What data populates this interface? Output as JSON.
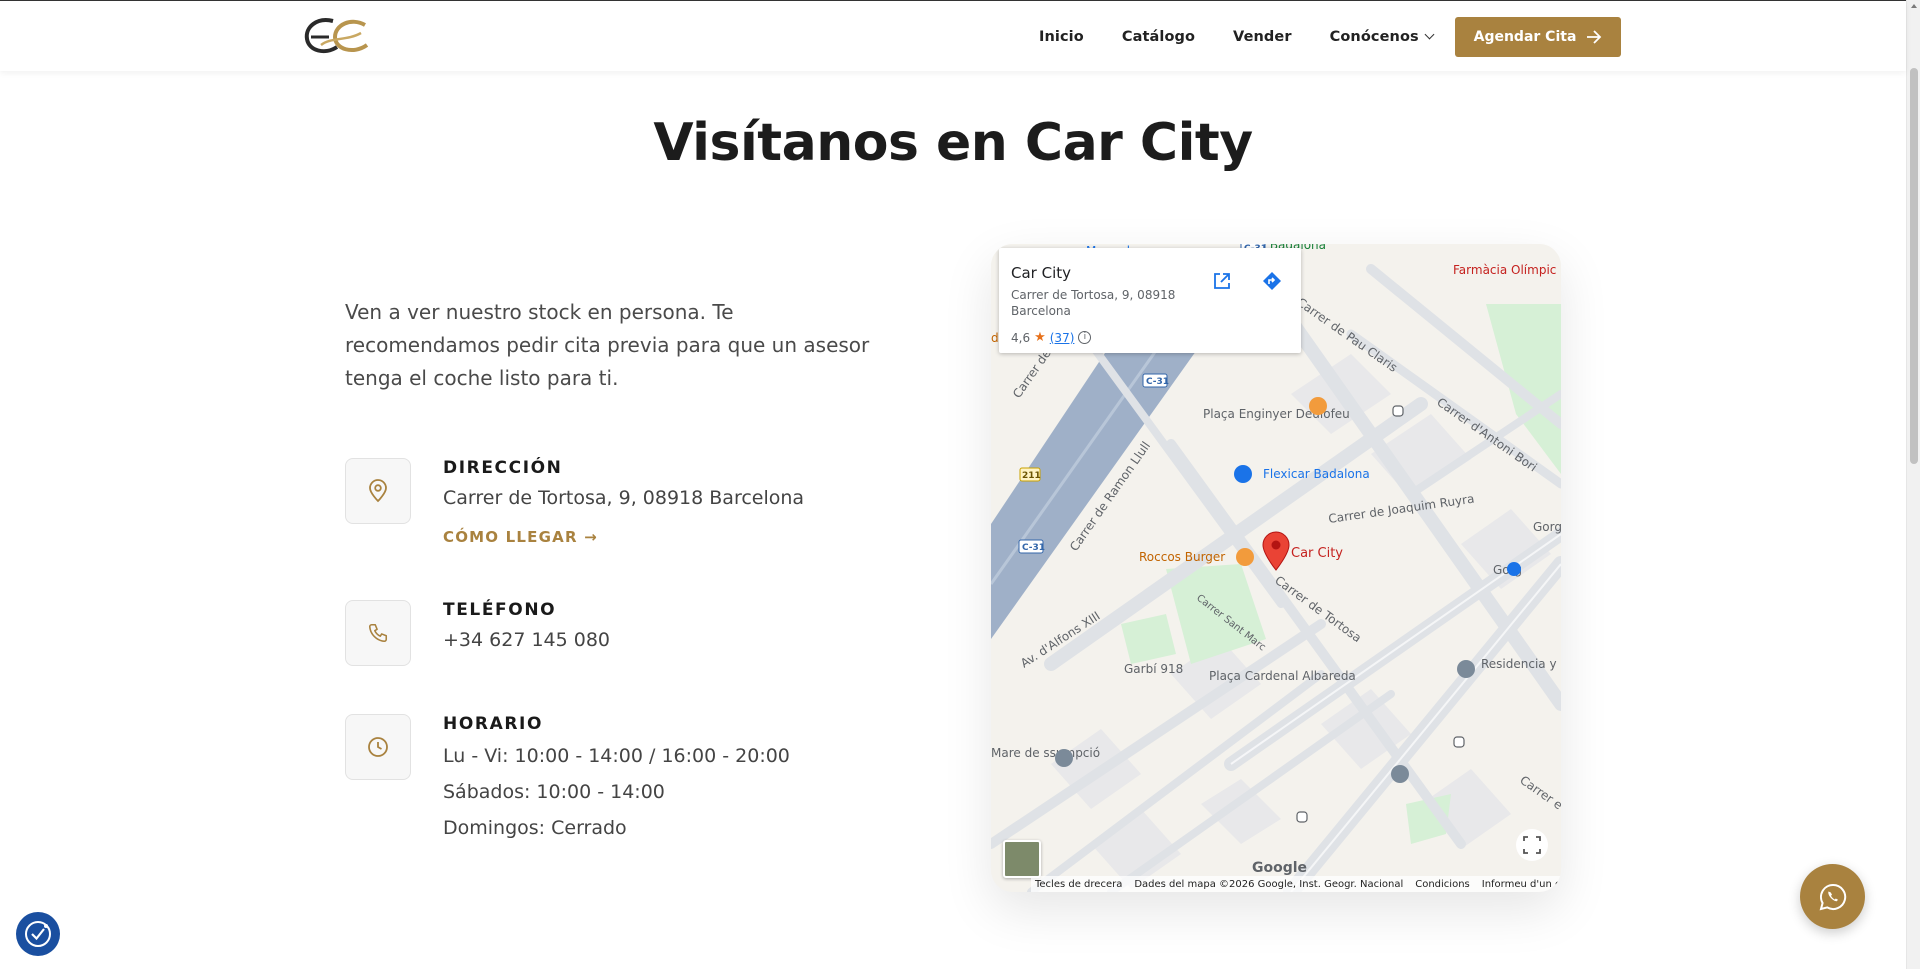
{
  "header": {
    "logo_icon": "ec-monogram-logo",
    "nav": [
      "Inicio",
      "Catálogo",
      "Vender",
      "Conócenos"
    ],
    "cta_label": "Agendar Cita",
    "accent": "#a9823f"
  },
  "section": {
    "title": "Visítanos en Car City",
    "intro": "Ven a ver nuestro stock en persona. Te recomendamos pedir cita previa para que un asesor tenga el coche listo para ti."
  },
  "address": {
    "label": "DIRECCIÓN",
    "value": "Carrer de Tortosa, 9, 08918 Barcelona",
    "link": "CÓMO LLEGAR →"
  },
  "phone": {
    "label": "TELÉFONO",
    "value": "+34 627 145 080"
  },
  "hours": {
    "label": "HORARIO",
    "lines": [
      "Lu - Vi: 10:00 - 14:00 / 16:00 - 20:00",
      "Sábados: 10:00 - 14:00",
      "Domingos: Cerrado"
    ]
  },
  "map": {
    "place_name": "Car City",
    "place_address": "Carrer de Tortosa, 9, 08918 Barcelona",
    "rating": "4,6",
    "reviews": "(37)",
    "labels": {
      "mercadona": "Mercadona",
      "de_badalona": "de Badalona",
      "farmacia": "Farmàcia Olímpic Badalona",
      "pau_claris": "Carrer de Pau Claris",
      "antoni_bori": "Carrer d'Antoni Bori",
      "placa_enginyer": "Plaça Enginyer Deulofeu",
      "flexicar": "Flexicar Badalona",
      "joaquim_ruyra": "Carrer de Joaquim Ruyra",
      "gorg1": "Gorg",
      "gorg2": "Gorg",
      "ramon_llull": "Carrer de Ramon Llull",
      "roccos": "Roccos Burger",
      "car_city": "Car City",
      "tortosa": "Carrer de Tortosa",
      "alfons": "Av. d'Alfons XIII",
      "sant_marc": "Carrer Sant Marc",
      "garbi": "Garbí 918",
      "placa_cardenal": "Plaça Cardenal Albareda",
      "residencia": "Residencia y día Colisée B",
      "mare_de": "Mare de ssumpció",
      "carrer_de": "Carrer de",
      "carrer_e": "Carrer e",
      "c31a": "C-31",
      "c31b": "C-31",
      "c31c": "C-31",
      "r211": "211",
      "dr": "dr"
    },
    "attribution": [
      "Tecles de drecera",
      "Dades del mapa ©2026 Google, Inst. Geogr. Nacional",
      "Condicions",
      "Informeu d'un error al map"
    ],
    "google": "Google"
  }
}
